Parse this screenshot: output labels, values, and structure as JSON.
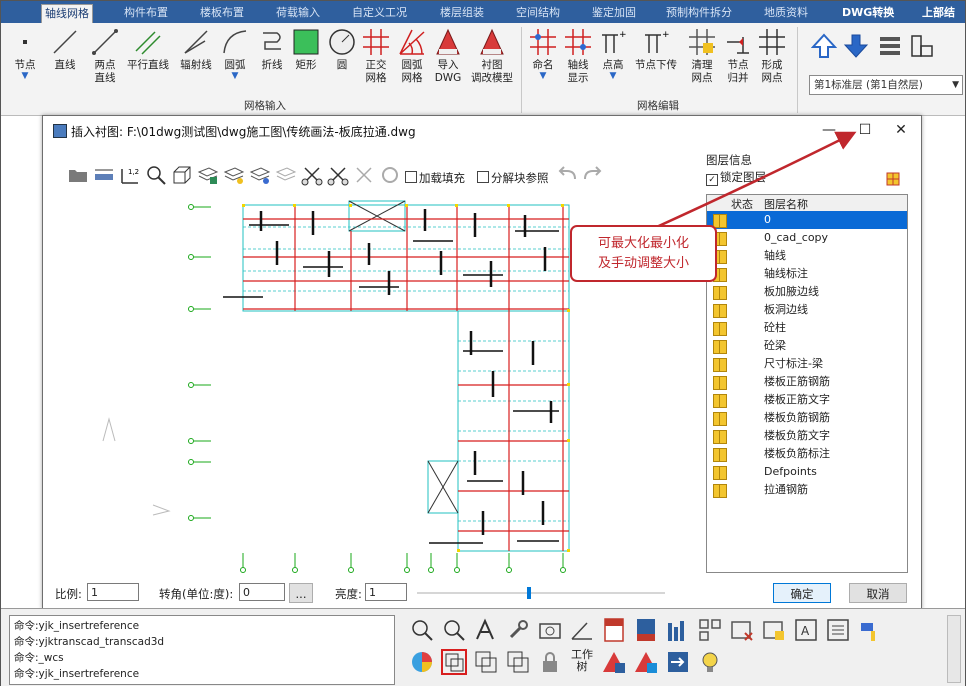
{
  "ribbon": {
    "tabs": [
      "轴线网格",
      "构件布置",
      "楼板布置",
      "荷载输入",
      "自定义工况",
      "楼层组装",
      "空间结构",
      "鉴定加固",
      "预制构件拆分",
      "地质资料",
      "DWG转换",
      "上部结构"
    ],
    "active_tab": "轴线网格",
    "buttons": [
      {
        "label": "节点",
        "sub": "",
        "caret": true
      },
      {
        "label": "直线",
        "sub": "",
        "caret": false
      },
      {
        "label": "两点",
        "sub": "直线",
        "caret": false
      },
      {
        "label": "平行直线",
        "sub": "",
        "caret": false
      },
      {
        "label": "辐射线",
        "sub": "",
        "caret": false
      },
      {
        "label": "圆弧",
        "sub": "",
        "caret": true
      },
      {
        "label": "折线",
        "sub": "",
        "caret": false
      },
      {
        "label": "矩形",
        "sub": "",
        "caret": false
      },
      {
        "label": "圆",
        "sub": "",
        "caret": false
      },
      {
        "label": "正交",
        "sub": "网格",
        "caret": false
      },
      {
        "label": "圆弧",
        "sub": "网格",
        "caret": false
      },
      {
        "label": "导入",
        "sub": "DWG",
        "caret": false
      },
      {
        "label": "衬图",
        "sub": "调改模型",
        "caret": false
      },
      {
        "label": "命名",
        "sub": "",
        "caret": true
      },
      {
        "label": "轴线",
        "sub": "显示",
        "caret": true
      },
      {
        "label": "点高",
        "sub": "",
        "caret": true
      },
      {
        "label": "节点下传",
        "sub": "",
        "caret": false
      },
      {
        "label": "清理",
        "sub": "网点",
        "caret": false
      },
      {
        "label": "节点",
        "sub": "归并",
        "caret": false
      },
      {
        "label": "形成",
        "sub": "网点",
        "caret": false
      }
    ],
    "group_labels": [
      "网格输入",
      "网格编辑"
    ],
    "floor_select": "第1标准层 (第1自然层)"
  },
  "dialog": {
    "title": "插入衬图: F:\\01dwg测试图\\dwg施工图\\传统画法-板底拉通.dwg",
    "checkbox_fill": "加载填充",
    "checkbox_decompose": "分解块参照",
    "layer_info_title": "图层信息",
    "lock_layer_label": "锁定图层",
    "lock_checked": "✓",
    "col_state": "状态",
    "col_name": "图层名称",
    "layers": [
      "0",
      "0_cad_copy",
      "轴线",
      "轴线标注",
      "板加腋边线",
      "板洞边线",
      "砼柱",
      "砼梁",
      "尺寸标注-梁",
      "楼板正筋钢筋",
      "楼板正筋文字",
      "楼板负筋钢筋",
      "楼板负筋文字",
      "楼板负筋标注",
      "Defpoints",
      "拉通钢筋"
    ],
    "selected_layer_index": 0,
    "scale_label": "比例:",
    "scale_value": "1",
    "angle_label": "转角(单位:度):",
    "angle_value": "0",
    "ellipsis": "...",
    "brightness_label": "亮度:",
    "brightness_value": "1",
    "brightness_level": 0.45,
    "ok": "确定",
    "cancel": "取消",
    "minimize": "—",
    "maximize": "☐",
    "close": "✕"
  },
  "callout": {
    "line1": "可最大化最小化",
    "line2": "及手动调整大小"
  },
  "command": {
    "lines": [
      "命令:yjk_insertreference",
      "命令:yjktranscad_transcad3d",
      "命令:_wcs",
      "命令:yjk_insertreference"
    ]
  },
  "colors": {
    "accent": "#2f5f9e",
    "callout": "#c0272d",
    "selection": "#0a6ad6",
    "layer_icon": "#f3c52e"
  }
}
